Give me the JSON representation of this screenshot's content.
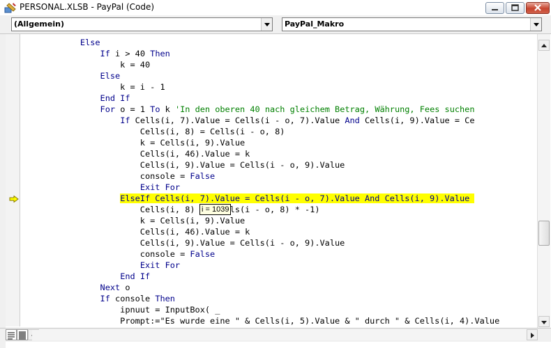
{
  "window": {
    "title": "PERSONAL.XLSB - PayPal (Code)",
    "close_color": "#c7452f"
  },
  "toolbar": {
    "object_combo": "(Allgemein)",
    "procedure_combo": "PayPal_Makro"
  },
  "editor": {
    "highlight_color": "#ffff00",
    "keyword_color": "#00008b",
    "comment_color": "#008000",
    "execution_line": 14,
    "tooltip": "i = 1039",
    "lines": [
      [
        {
          "t": "            "
        },
        {
          "t": "Else",
          "k": 1
        }
      ],
      [
        {
          "t": "                "
        },
        {
          "t": "If",
          "k": 1
        },
        {
          "t": " i > 40 "
        },
        {
          "t": "Then",
          "k": 1
        }
      ],
      [
        {
          "t": "                    k = 40"
        }
      ],
      [
        {
          "t": "                "
        },
        {
          "t": "Else",
          "k": 1
        }
      ],
      [
        {
          "t": "                    k = i - 1"
        }
      ],
      [
        {
          "t": "                "
        },
        {
          "t": "End If",
          "k": 1
        }
      ],
      [
        {
          "t": "                "
        },
        {
          "t": "For",
          "k": 1
        },
        {
          "t": " o = 1 "
        },
        {
          "t": "To",
          "k": 1
        },
        {
          "t": " k "
        },
        {
          "t": "'In den oberen 40 nach gleichem Betrag, Währung, Fees suchen",
          "c": 1
        }
      ],
      [
        {
          "t": "                    "
        },
        {
          "t": "If",
          "k": 1
        },
        {
          "t": " Cells(i, 7).Value = Cells(i - o, 7).Value "
        },
        {
          "t": "And",
          "k": 1
        },
        {
          "t": " Cells(i, 9).Value = Ce"
        }
      ],
      [
        {
          "t": "                        Cells(i, 8) = Cells(i - o, 8)"
        }
      ],
      [
        {
          "t": "                        k = Cells(i, 9).Value"
        }
      ],
      [
        {
          "t": "                        Cells(i, 46).Value = k"
        }
      ],
      [
        {
          "t": "                        Cells(i, 9).Value = Cells(i - o, 9).Value"
        }
      ],
      [
        {
          "t": "                        console = "
        },
        {
          "t": "False",
          "k": 1
        }
      ],
      [
        {
          "t": "                        "
        },
        {
          "t": "Exit For",
          "k": 1
        }
      ],
      [
        {
          "t": "                    "
        },
        {
          "t": "ElseIf Cells(i, 7).Value = Cells(i - o, 7).Value And Cells(i, 9).Value ",
          "h": 1
        }
      ],
      [
        {
          "t": "                        Cells(i, 8) = (Cells(i - o, 8) * -1)"
        }
      ],
      [
        {
          "t": "                        k = Cells(i, 9).Value"
        }
      ],
      [
        {
          "t": "                        Cells(i, 46).Value = k"
        }
      ],
      [
        {
          "t": "                        Cells(i, 9).Value = Cells(i - o, 9).Value"
        }
      ],
      [
        {
          "t": "                        console = "
        },
        {
          "t": "False",
          "k": 1
        }
      ],
      [
        {
          "t": "                        "
        },
        {
          "t": "Exit For",
          "k": 1
        }
      ],
      [
        {
          "t": "                    "
        },
        {
          "t": "End If",
          "k": 1
        }
      ],
      [
        {
          "t": "                "
        },
        {
          "t": "Next",
          "k": 1
        },
        {
          "t": " o"
        }
      ],
      [
        {
          "t": "                "
        },
        {
          "t": "If",
          "k": 1
        },
        {
          "t": " console "
        },
        {
          "t": "Then",
          "k": 1
        }
      ],
      [
        {
          "t": "                    ipnuut = InputBox( _"
        }
      ],
      [
        {
          "t": "                    Prompt:=\"Es wurde eine \" & Cells(i, 5).Value & \" durch \" & Cells(i, 4).Value"
        }
      ]
    ]
  }
}
